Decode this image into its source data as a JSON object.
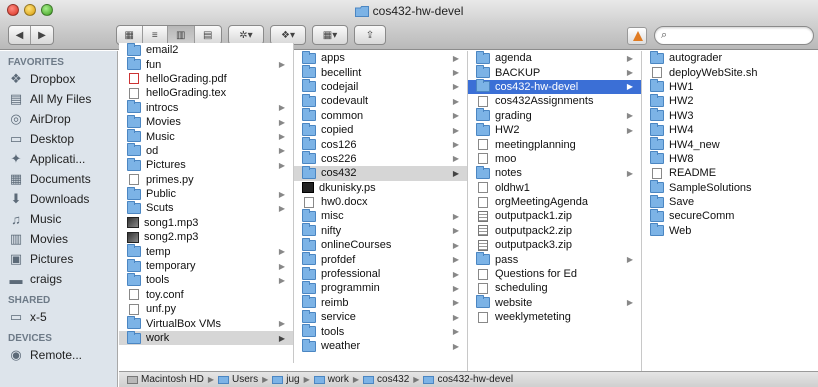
{
  "window": {
    "title": "cos432-hw-devel"
  },
  "search": {
    "placeholder": "",
    "value": ""
  },
  "sidebar": {
    "favorites_heading": "FAVORITES",
    "favorites": [
      {
        "label": "Dropbox",
        "icon": "dropbox-icon",
        "glyph": "❖"
      },
      {
        "label": "All My Files",
        "icon": "all-files-icon",
        "glyph": "▤"
      },
      {
        "label": "AirDrop",
        "icon": "airdrop-icon",
        "glyph": "◎"
      },
      {
        "label": "Desktop",
        "icon": "desktop-icon",
        "glyph": "▭"
      },
      {
        "label": "Applicati...",
        "icon": "applications-icon",
        "glyph": "✦"
      },
      {
        "label": "Documents",
        "icon": "documents-icon",
        "glyph": "▦"
      },
      {
        "label": "Downloads",
        "icon": "downloads-icon",
        "glyph": "⬇"
      },
      {
        "label": "Music",
        "icon": "music-icon",
        "glyph": "♫"
      },
      {
        "label": "Movies",
        "icon": "movies-icon",
        "glyph": "▥"
      },
      {
        "label": "Pictures",
        "icon": "pictures-icon",
        "glyph": "▣"
      },
      {
        "label": "craigs",
        "icon": "home-folder-icon",
        "glyph": "▬"
      }
    ],
    "shared_heading": "SHARED",
    "shared": [
      {
        "label": "x-5",
        "icon": "computer-icon",
        "glyph": "▭"
      }
    ],
    "devices_heading": "DEVICES",
    "devices": [
      {
        "label": "Remote...",
        "icon": "remote-disc-icon",
        "glyph": "◉"
      }
    ]
  },
  "columns": [
    {
      "items": [
        {
          "name": "email2",
          "type": "folder",
          "arrow": false
        },
        {
          "name": "fun",
          "type": "folder",
          "arrow": true
        },
        {
          "name": "helloGrading.pdf",
          "type": "pdf",
          "arrow": false
        },
        {
          "name": "helloGrading.tex",
          "type": "doc",
          "arrow": false
        },
        {
          "name": "introcs",
          "type": "folder",
          "arrow": true
        },
        {
          "name": "Movies",
          "type": "folder",
          "arrow": true
        },
        {
          "name": "Music",
          "type": "folder",
          "arrow": true
        },
        {
          "name": "od",
          "type": "folder",
          "arrow": true
        },
        {
          "name": "Pictures",
          "type": "folder",
          "arrow": true
        },
        {
          "name": "primes.py",
          "type": "doc",
          "arrow": false
        },
        {
          "name": "Public",
          "type": "folder",
          "arrow": true
        },
        {
          "name": "Scuts",
          "type": "folder",
          "arrow": true
        },
        {
          "name": "song1.mp3",
          "type": "img",
          "arrow": false
        },
        {
          "name": "song2.mp3",
          "type": "img",
          "arrow": false
        },
        {
          "name": "temp",
          "type": "folder",
          "arrow": true
        },
        {
          "name": "temporary",
          "type": "folder",
          "arrow": true
        },
        {
          "name": "tools",
          "type": "folder",
          "arrow": true
        },
        {
          "name": "toy.conf",
          "type": "doc",
          "arrow": false
        },
        {
          "name": "unf.py",
          "type": "doc",
          "arrow": false
        },
        {
          "name": "VirtualBox VMs",
          "type": "folder",
          "arrow": true
        },
        {
          "name": "work",
          "type": "folder",
          "arrow": true,
          "state": "parent"
        }
      ]
    },
    {
      "items": [
        {
          "name": "apps",
          "type": "folder",
          "arrow": true
        },
        {
          "name": "becellint",
          "type": "folder",
          "arrow": true
        },
        {
          "name": "codejail",
          "type": "folder",
          "arrow": true
        },
        {
          "name": "codevault",
          "type": "folder",
          "arrow": true
        },
        {
          "name": "common",
          "type": "folder",
          "arrow": true
        },
        {
          "name": "copied",
          "type": "folder",
          "arrow": true
        },
        {
          "name": "cos126",
          "type": "folder",
          "arrow": true
        },
        {
          "name": "cos226",
          "type": "folder",
          "arrow": true
        },
        {
          "name": "cos432",
          "type": "folder",
          "arrow": true,
          "state": "parent"
        },
        {
          "name": "dkunisky.ps",
          "type": "dark",
          "arrow": false
        },
        {
          "name": "hw0.docx",
          "type": "doc",
          "arrow": false
        },
        {
          "name": "misc",
          "type": "folder",
          "arrow": true
        },
        {
          "name": "nifty",
          "type": "folder",
          "arrow": true
        },
        {
          "name": "onlineCourses",
          "type": "folder",
          "arrow": true
        },
        {
          "name": "profdef",
          "type": "folder",
          "arrow": true
        },
        {
          "name": "professional",
          "type": "folder",
          "arrow": true
        },
        {
          "name": "programmin",
          "type": "folder",
          "arrow": true
        },
        {
          "name": "reimb",
          "type": "folder",
          "arrow": true
        },
        {
          "name": "service",
          "type": "folder",
          "arrow": true
        },
        {
          "name": "tools",
          "type": "folder",
          "arrow": true
        },
        {
          "name": "weather",
          "type": "folder",
          "arrow": true
        }
      ]
    },
    {
      "items": [
        {
          "name": "agenda",
          "type": "folder",
          "arrow": true
        },
        {
          "name": "BACKUP",
          "type": "folder",
          "arrow": true
        },
        {
          "name": "cos432-hw-devel",
          "type": "folder",
          "arrow": true,
          "state": "selected"
        },
        {
          "name": "cos432Assignments",
          "type": "doc",
          "arrow": false
        },
        {
          "name": "grading",
          "type": "folder",
          "arrow": true
        },
        {
          "name": "HW2",
          "type": "folder",
          "arrow": true
        },
        {
          "name": "meetingplanning",
          "type": "doc",
          "arrow": false
        },
        {
          "name": "moo",
          "type": "doc",
          "arrow": false
        },
        {
          "name": "notes",
          "type": "folder",
          "arrow": true
        },
        {
          "name": "oldhw1",
          "type": "doc",
          "arrow": false
        },
        {
          "name": "orgMeetingAgenda",
          "type": "doc",
          "arrow": false
        },
        {
          "name": "outputpack1.zip",
          "type": "zip",
          "arrow": false
        },
        {
          "name": "outputpack2.zip",
          "type": "zip",
          "arrow": false
        },
        {
          "name": "outputpack3.zip",
          "type": "zip",
          "arrow": false
        },
        {
          "name": "pass",
          "type": "folder",
          "arrow": true
        },
        {
          "name": "Questions for Ed",
          "type": "doc",
          "arrow": false
        },
        {
          "name": "scheduling",
          "type": "doc",
          "arrow": false
        },
        {
          "name": "website",
          "type": "folder",
          "arrow": true
        },
        {
          "name": "weeklymeteting",
          "type": "doc",
          "arrow": false
        }
      ]
    },
    {
      "items": [
        {
          "name": "autograder",
          "type": "folder",
          "arrow": false
        },
        {
          "name": "deployWebSite.sh",
          "type": "doc",
          "arrow": false
        },
        {
          "name": "HW1",
          "type": "folder",
          "arrow": false
        },
        {
          "name": "HW2",
          "type": "folder",
          "arrow": false
        },
        {
          "name": "HW3",
          "type": "folder",
          "arrow": false
        },
        {
          "name": "HW4",
          "type": "folder",
          "arrow": false
        },
        {
          "name": "HW4_new",
          "type": "folder",
          "arrow": false
        },
        {
          "name": "HW8",
          "type": "folder",
          "arrow": false
        },
        {
          "name": "README",
          "type": "doc",
          "arrow": false
        },
        {
          "name": "SampleSolutions",
          "type": "folder",
          "arrow": false
        },
        {
          "name": "Save",
          "type": "folder",
          "arrow": false
        },
        {
          "name": "secureComm",
          "type": "folder",
          "arrow": false
        },
        {
          "name": "Web",
          "type": "folder",
          "arrow": false
        }
      ]
    }
  ],
  "pathbar": [
    "Macintosh HD",
    "Users",
    "jug",
    "work",
    "cos432",
    "cos432-hw-devel"
  ],
  "colors": {
    "selection": "#3b6fd6",
    "folder": "#7cb3e6",
    "sidebar_bg": "#dde4eb"
  }
}
